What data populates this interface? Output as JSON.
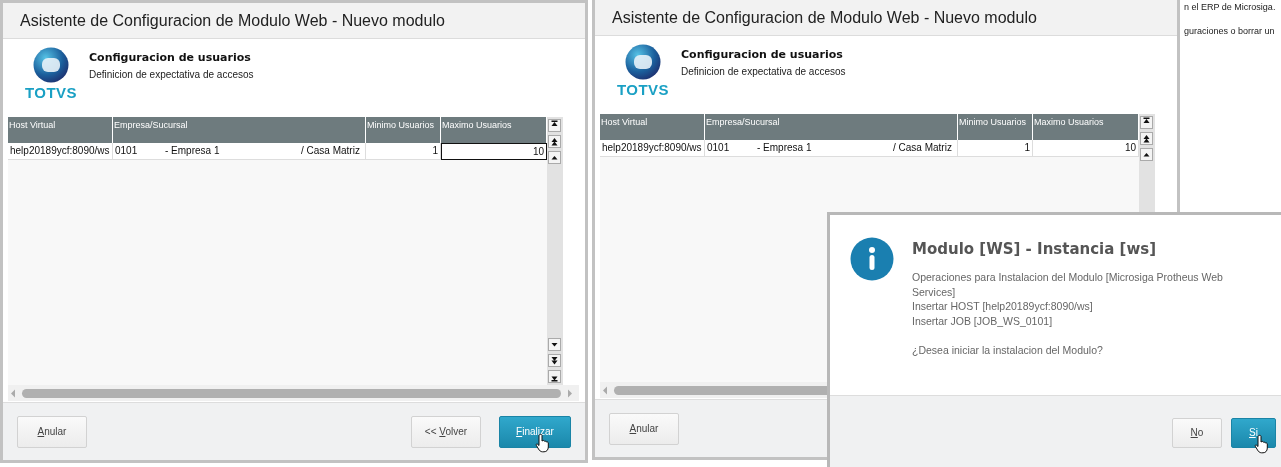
{
  "windows": [
    {
      "title": "Asistente de Configuracion de Modulo Web - Nuevo modulo",
      "logo": "TOTVS",
      "heading": "Configuracion de usuarios",
      "subheading": "Definicion de expectativa de accesos",
      "table": {
        "columns": [
          "Host Virtual",
          "Empresa/Sucursal",
          "Minimo Usuarios",
          "Maximo Usuarios"
        ],
        "rows": [
          {
            "host": "help20189ycf:8090/ws",
            "company_code": "0101",
            "company_name": "- Empresa 1",
            "branch": "/ Casa Matriz",
            "minimo": "1",
            "maximo": "10",
            "editing": true
          }
        ],
        "bottom_scroll_visible": true
      },
      "buttons": [
        {
          "kind": "cancel",
          "accel": "A",
          "rest": "nular",
          "pointer": false
        },
        {
          "kind": "back",
          "prefix": "<< ",
          "accel": "V",
          "rest": "olver",
          "pointer": false
        },
        {
          "kind": "primary",
          "accel": "F",
          "rest": "inalizar",
          "pointer": true
        }
      ]
    },
    {
      "title": "Asistente de Configuracion de Modulo Web - Nuevo modulo",
      "logo": "TOTVS",
      "heading": "Configuracion de usuarios",
      "subheading": "Definicion de expectativa de accesos",
      "table": {
        "columns": [
          "Host Virtual",
          "Empresa/Sucursal",
          "Minimo Usuarios",
          "Maximo Usuarios"
        ],
        "rows": [
          {
            "host": "help20189ycf:8090/ws",
            "company_code": "0101",
            "company_name": "- Empresa 1",
            "branch": "/ Casa Matriz",
            "minimo": "1",
            "maximo": "10",
            "editing": false
          }
        ]
      },
      "buttons": [
        {
          "kind": "cancel",
          "accel": "A",
          "rest": "nular",
          "pointer": false
        }
      ]
    }
  ],
  "background_text": [
    "n el ERP de Microsiga.",
    "guraciones o borrar un"
  ],
  "dialog": {
    "title": "Modulo [WS] - Instancia [ws]",
    "lines": [
      "Operaciones para Instalacion del Modulo [Microsiga Protheus Web Services]",
      "Insertar HOST [help20189ycf:8090/ws]",
      "Insertar JOB [JOB_WS_0101]"
    ],
    "question": "¿Desea iniciar la instalacion del Modulo?",
    "buttons": [
      {
        "kind": "default",
        "accel": "N",
        "rest": "o",
        "pointer": false
      },
      {
        "kind": "primary",
        "accel": "S",
        "rest": "i",
        "pointer": true
      }
    ]
  }
}
